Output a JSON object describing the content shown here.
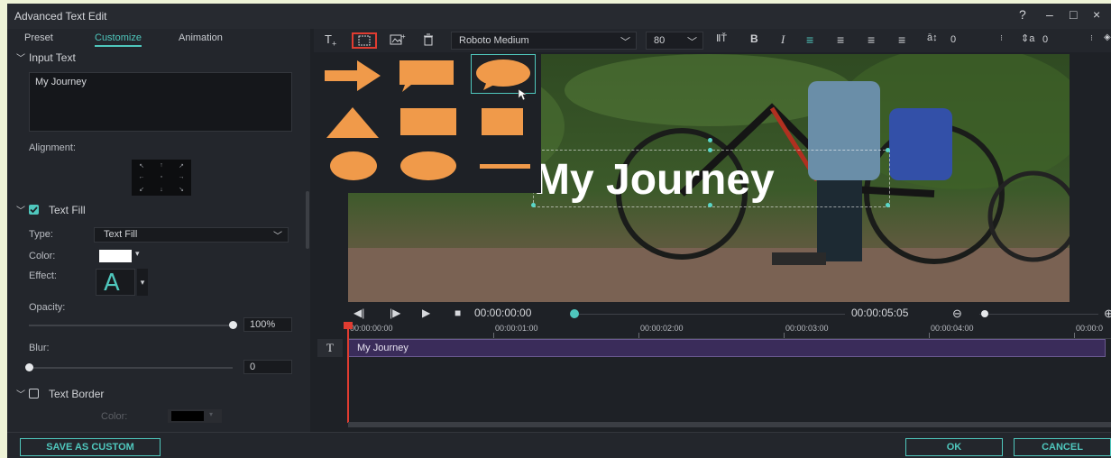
{
  "window": {
    "title": "Advanced Text Edit",
    "help": "?",
    "minimize": "–",
    "maximize": "□",
    "close": "×"
  },
  "tabs": [
    "Preset",
    "Customize",
    "Animation"
  ],
  "input_text": {
    "header": "Input Text",
    "value": "My Journey"
  },
  "alignment": {
    "label": "Alignment:"
  },
  "text_fill": {
    "header": "Text Fill",
    "checked": true,
    "type_label": "Type:",
    "type_value": "Text Fill",
    "color_label": "Color:",
    "color_value": "#ffffff",
    "effect_label": "Effect:",
    "effect_glyph": "A",
    "opacity_label": "Opacity:",
    "opacity_value": "100%",
    "opacity_fraction": 1.0,
    "blur_label": "Blur:",
    "blur_value": "0",
    "blur_fraction": 0.0
  },
  "text_border": {
    "header": "Text Border",
    "checked": false,
    "color_label": "Color:",
    "color_value": "#000000"
  },
  "toolbar": {
    "font": "Roboto Medium",
    "size": "80",
    "bold": "B",
    "italic": "I",
    "char_spacing": "0",
    "line_spacing": "0"
  },
  "preview": {
    "overlay_text": "My Journey"
  },
  "shapes_popup": {
    "selected": "speech-bubble-round"
  },
  "transport": {
    "current_time": "00:00:00:00",
    "duration": "00:00:05:05"
  },
  "timeline": {
    "ticks": [
      "00:00:00:00",
      "00:00:01:00",
      "00:00:02:00",
      "00:00:03:00",
      "00:00:04:00",
      "00:00:0"
    ],
    "track_icon": "T",
    "clip_label": "My Journey"
  },
  "buttons": {
    "save_custom": "SAVE AS CUSTOM",
    "ok": "OK",
    "cancel": "CANCEL"
  },
  "colors": {
    "accent": "#4fc7bd",
    "shape": "#f09a4a",
    "highlight": "#e03c31",
    "clip": "#3a2c5a"
  }
}
